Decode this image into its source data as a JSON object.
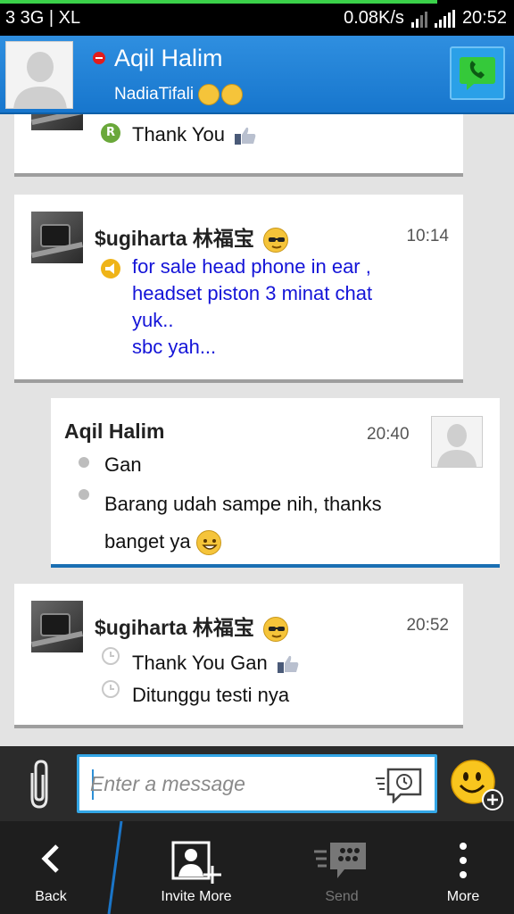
{
  "status_bar": {
    "carrier": "3 3G | XL",
    "speed": "0.08K/s",
    "time": "20:52"
  },
  "header": {
    "contact_name": "Aqil Halim",
    "status_message": "NadiaTifali",
    "status_emoji": "hugging-emoji"
  },
  "messages": [
    {
      "partial": true,
      "badge": "R",
      "text": "Thank You",
      "emoji": "thumbs-up"
    },
    {
      "sender": "$ugiharta 林福宝",
      "sender_emoji": "sunglasses-emoji",
      "time": "10:14",
      "type": "broadcast",
      "text_lines": [
        "for sale head phone in ear ,",
        "headset piston 3 minat chat",
        "yuk..",
        "sbc yah..."
      ]
    },
    {
      "sender": "Aqil Halim",
      "time": "20:40",
      "outgoing": true,
      "lines": [
        "Gan",
        "Barang udah sampe nih, thanks",
        "banget ya"
      ],
      "trailing_emoji": "grinning-emoji"
    },
    {
      "sender": "$ugiharta 林福宝",
      "sender_emoji": "sunglasses-emoji",
      "time": "20:52",
      "lines": [
        "Thank You Gan",
        "Ditunggu testi nya"
      ],
      "line_emojis": [
        "thumbs-up",
        ""
      ]
    }
  ],
  "composer": {
    "placeholder": "Enter a message"
  },
  "bottom_nav": {
    "back": "Back",
    "invite": "Invite More",
    "send": "Send",
    "more": "More"
  },
  "colors": {
    "header_blue": "#1f80d6",
    "input_border": "#33a6e6",
    "broadcast_text": "#1414d8",
    "outgoing_accent": "#1a6fb3"
  }
}
